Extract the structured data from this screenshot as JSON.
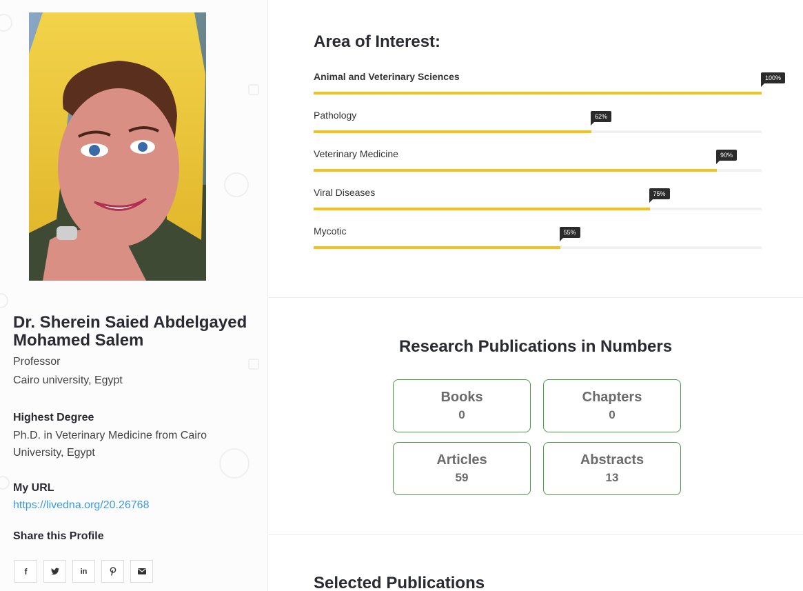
{
  "profile": {
    "name": "Dr. Sherein Saied Abdelgayed Mohamed Salem",
    "role": "Professor",
    "affiliation": "Cairo university, Egypt",
    "highest_degree_label": "Highest Degree",
    "highest_degree": "Ph.D. in Veterinary Medicine from Cairo University, Egypt",
    "url_label": "My URL",
    "url": "https://livedna.org/20.26768",
    "share_label": "Share this Profile",
    "share_icons": [
      "facebook-icon",
      "twitter-icon",
      "linkedin-icon",
      "pinterest-icon",
      "email-icon"
    ]
  },
  "interests": {
    "title": "Area of Interest:",
    "items": [
      {
        "label": "Animal and Veterinary Sciences",
        "percent": 100,
        "percent_label": "100%"
      },
      {
        "label": "Pathology",
        "percent": 62,
        "percent_label": "62%"
      },
      {
        "label": "Veterinary Medicine",
        "percent": 90,
        "percent_label": "90%"
      },
      {
        "label": "Viral Diseases",
        "percent": 75,
        "percent_label": "75%"
      },
      {
        "label": "Mycotic",
        "percent": 55,
        "percent_label": "55%"
      }
    ],
    "bar_color": "#f5c01c"
  },
  "publications": {
    "title": "Research Publications in Numbers",
    "items": [
      {
        "label": "Books",
        "count": "0"
      },
      {
        "label": "Chapters",
        "count": "0"
      },
      {
        "label": "Articles",
        "count": "59"
      },
      {
        "label": "Abstracts",
        "count": "13"
      }
    ],
    "border_color": "#4a9a4a"
  },
  "selected": {
    "title": "Selected Publications"
  },
  "colors": {
    "link": "#3a9ad9",
    "text": "#2a2a33"
  }
}
